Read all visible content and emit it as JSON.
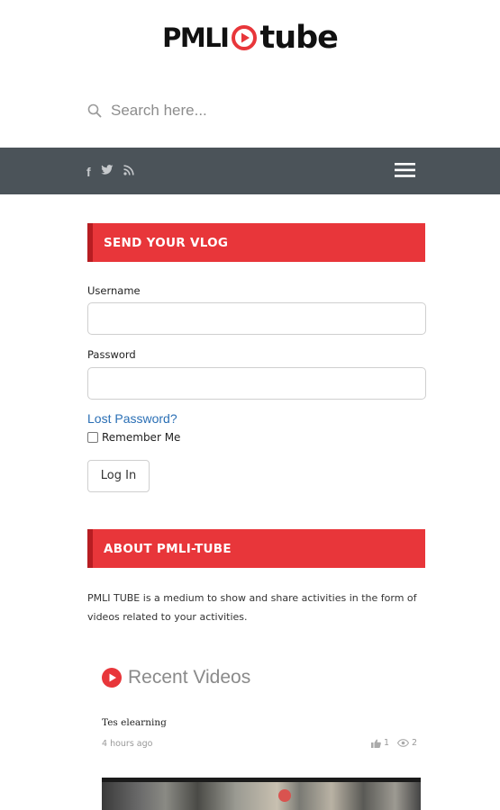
{
  "site": {
    "logo_left": "PMLI",
    "logo_right": "tube"
  },
  "search": {
    "placeholder": "Search here..."
  },
  "navbar": {
    "social_icons": [
      "facebook-icon",
      "twitter-icon",
      "rss-icon"
    ],
    "menu_icon": "hamburger-menu-icon"
  },
  "login_widget": {
    "title": "SEND YOUR VLOG",
    "username_label": "Username",
    "username_value": "",
    "password_label": "Password",
    "password_value": "",
    "lost_password": "Lost Password?",
    "remember_me": "Remember Me",
    "remember_checked": false,
    "login_button": "Log In"
  },
  "about_widget": {
    "title": "ABOUT PMLI-TUBE",
    "text": "PMLI TUBE is a medium to show and share activities in the form of videos related to your activities."
  },
  "recent_videos": {
    "heading": "Recent Videos",
    "items": [
      {
        "title": "Tes elearning",
        "time": "4 hours ago",
        "likes": "1",
        "views": "2"
      }
    ]
  },
  "colors": {
    "accent": "#e8363a",
    "navbar": "#4b5359",
    "link": "#2a6fb5"
  }
}
